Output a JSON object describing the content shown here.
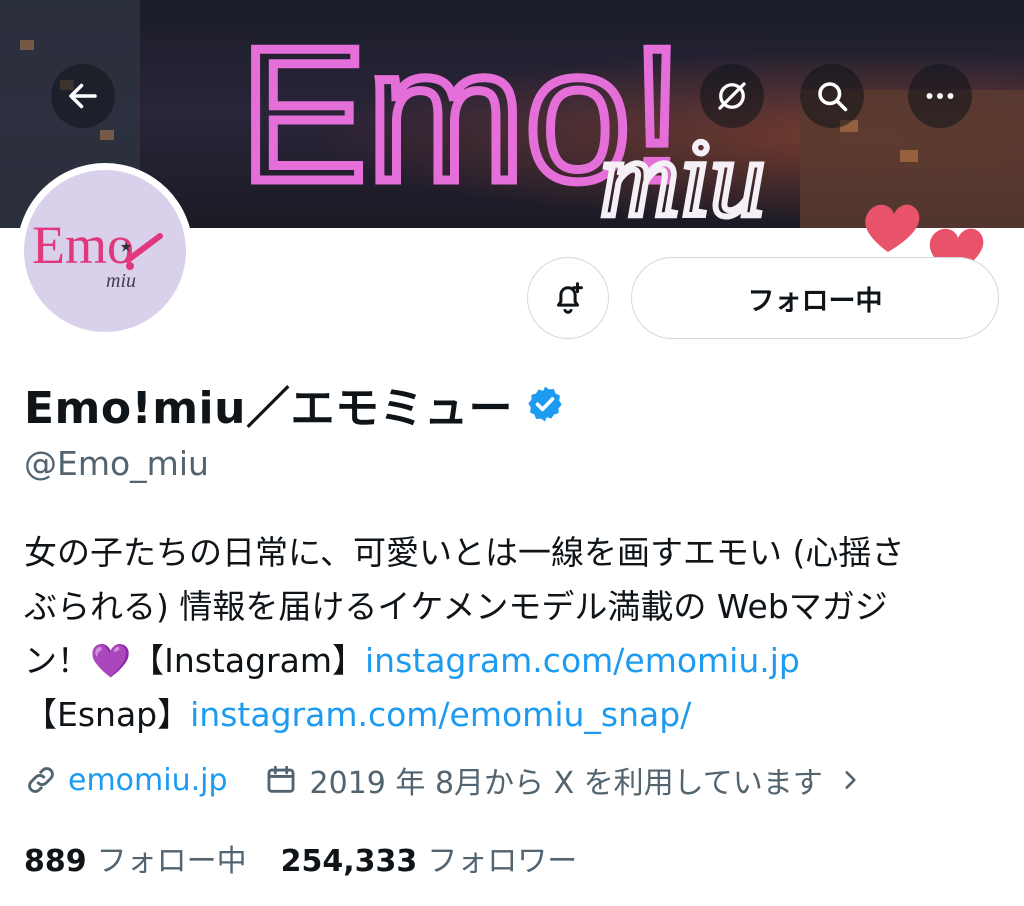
{
  "header": {
    "back_icon": "arrow-left-icon",
    "grok_icon": "grok-icon",
    "search_icon": "search-icon",
    "more_icon": "more-horizontal-icon"
  },
  "banner": {
    "neon_text": "Emo!",
    "neon_sub": "miu"
  },
  "avatar": {
    "logo_text": "Emo",
    "logo_sub": "miu"
  },
  "actions": {
    "notify_icon": "bell-plus-icon",
    "follow_label": "フォロー中"
  },
  "profile": {
    "display_name": "Emo!miu／エモミュー",
    "verified_icon": "verified-badge-icon",
    "verified_color": "#1d9bf0",
    "handle": "@Emo_miu",
    "bio_line1": "女の子たちの日常に、可愛いとは一線を画すエモい (心揺さ",
    "bio_line2": "ぶられる) 情報を届けるイケメンモデル満載の Webマガジ",
    "bio_line3_text": "ン！💜【Instagram】",
    "bio_link1": "instagram.com/emomiu.jp",
    "bio_line4_text": "【Esnap】",
    "bio_link2": "instagram.com/emomiu_snap/"
  },
  "meta": {
    "link_icon": "link-icon",
    "website": "emomiu.jp",
    "calendar_icon": "calendar-icon",
    "joined": "2019 年 8月から X を利用しています",
    "chevron_icon": "chevron-right-icon"
  },
  "stats": {
    "following_count": "889",
    "following_label": "フォロー中",
    "followers_count": "254,333",
    "followers_label": "フォロワー"
  },
  "colors": {
    "accent": "#1d9bf0",
    "text": "#0f1419",
    "muted": "#536471",
    "neon": "#e46fd8"
  }
}
